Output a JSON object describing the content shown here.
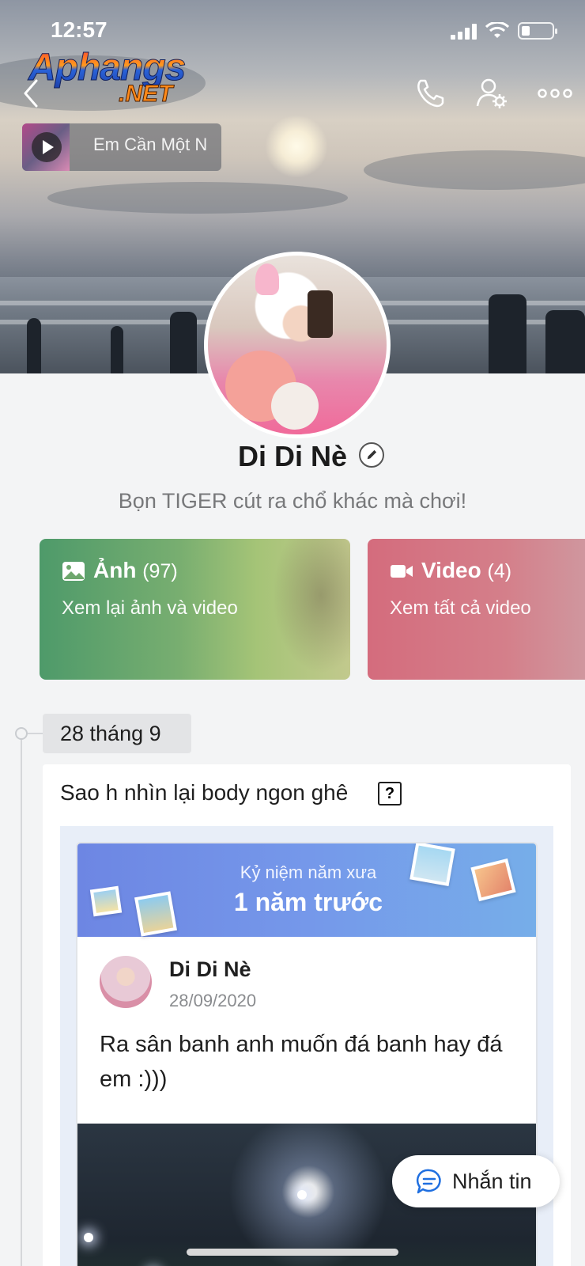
{
  "status_bar": {
    "time": "12:57"
  },
  "watermark": {
    "line1": "Aphangs",
    "line2": ".NET"
  },
  "music": {
    "title": "Em Cần Một N"
  },
  "profile": {
    "name": "Di Di Nè",
    "bio": "Bọn TIGER cút ra chổ khác mà chơi!"
  },
  "media_cards": {
    "photos": {
      "title": "Ảnh",
      "count": "(97)",
      "subtitle": "Xem lại ảnh và video"
    },
    "videos": {
      "title": "Video",
      "count": "(4)",
      "subtitle": "Xem tất cả video"
    }
  },
  "timeline": {
    "date": "28 tháng 9",
    "post": {
      "caption": "Sao h nhìn lại body ngon ghê",
      "caption_icon": "?",
      "memory": {
        "label": "Kỷ niệm năm xưa",
        "period": "1 năm trước",
        "author": "Di Di Nè",
        "date": "28/09/2020",
        "text": "Ra sân banh anh muốn đá banh hay đá em :)))"
      }
    }
  },
  "fab": {
    "label": "Nhắn tin"
  },
  "colors": {
    "photo_card": "#6ea76d",
    "video_card": "#d47681",
    "memory_header": "#7598ea"
  },
  "icons": [
    "back-icon",
    "phone-icon",
    "user-settings-icon",
    "more-icon",
    "play-icon",
    "image-icon",
    "video-camera-icon",
    "edit-pencil-icon",
    "message-icon"
  ]
}
